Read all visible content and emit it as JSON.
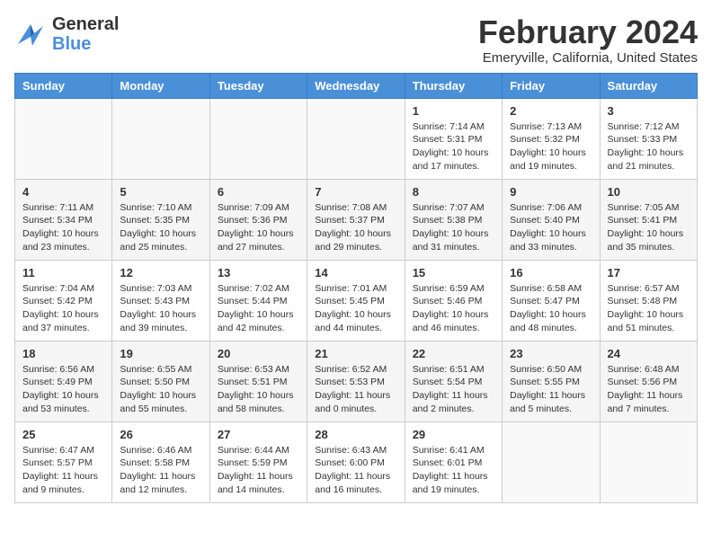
{
  "logo": {
    "general": "General",
    "blue": "Blue"
  },
  "title": "February 2024",
  "location": "Emeryville, California, United States",
  "days_of_week": [
    "Sunday",
    "Monday",
    "Tuesday",
    "Wednesday",
    "Thursday",
    "Friday",
    "Saturday"
  ],
  "weeks": [
    [
      {
        "day": "",
        "info": ""
      },
      {
        "day": "",
        "info": ""
      },
      {
        "day": "",
        "info": ""
      },
      {
        "day": "",
        "info": ""
      },
      {
        "day": "1",
        "info": "Sunrise: 7:14 AM\nSunset: 5:31 PM\nDaylight: 10 hours\nand 17 minutes."
      },
      {
        "day": "2",
        "info": "Sunrise: 7:13 AM\nSunset: 5:32 PM\nDaylight: 10 hours\nand 19 minutes."
      },
      {
        "day": "3",
        "info": "Sunrise: 7:12 AM\nSunset: 5:33 PM\nDaylight: 10 hours\nand 21 minutes."
      }
    ],
    [
      {
        "day": "4",
        "info": "Sunrise: 7:11 AM\nSunset: 5:34 PM\nDaylight: 10 hours\nand 23 minutes."
      },
      {
        "day": "5",
        "info": "Sunrise: 7:10 AM\nSunset: 5:35 PM\nDaylight: 10 hours\nand 25 minutes."
      },
      {
        "day": "6",
        "info": "Sunrise: 7:09 AM\nSunset: 5:36 PM\nDaylight: 10 hours\nand 27 minutes."
      },
      {
        "day": "7",
        "info": "Sunrise: 7:08 AM\nSunset: 5:37 PM\nDaylight: 10 hours\nand 29 minutes."
      },
      {
        "day": "8",
        "info": "Sunrise: 7:07 AM\nSunset: 5:38 PM\nDaylight: 10 hours\nand 31 minutes."
      },
      {
        "day": "9",
        "info": "Sunrise: 7:06 AM\nSunset: 5:40 PM\nDaylight: 10 hours\nand 33 minutes."
      },
      {
        "day": "10",
        "info": "Sunrise: 7:05 AM\nSunset: 5:41 PM\nDaylight: 10 hours\nand 35 minutes."
      }
    ],
    [
      {
        "day": "11",
        "info": "Sunrise: 7:04 AM\nSunset: 5:42 PM\nDaylight: 10 hours\nand 37 minutes."
      },
      {
        "day": "12",
        "info": "Sunrise: 7:03 AM\nSunset: 5:43 PM\nDaylight: 10 hours\nand 39 minutes."
      },
      {
        "day": "13",
        "info": "Sunrise: 7:02 AM\nSunset: 5:44 PM\nDaylight: 10 hours\nand 42 minutes."
      },
      {
        "day": "14",
        "info": "Sunrise: 7:01 AM\nSunset: 5:45 PM\nDaylight: 10 hours\nand 44 minutes."
      },
      {
        "day": "15",
        "info": "Sunrise: 6:59 AM\nSunset: 5:46 PM\nDaylight: 10 hours\nand 46 minutes."
      },
      {
        "day": "16",
        "info": "Sunrise: 6:58 AM\nSunset: 5:47 PM\nDaylight: 10 hours\nand 48 minutes."
      },
      {
        "day": "17",
        "info": "Sunrise: 6:57 AM\nSunset: 5:48 PM\nDaylight: 10 hours\nand 51 minutes."
      }
    ],
    [
      {
        "day": "18",
        "info": "Sunrise: 6:56 AM\nSunset: 5:49 PM\nDaylight: 10 hours\nand 53 minutes."
      },
      {
        "day": "19",
        "info": "Sunrise: 6:55 AM\nSunset: 5:50 PM\nDaylight: 10 hours\nand 55 minutes."
      },
      {
        "day": "20",
        "info": "Sunrise: 6:53 AM\nSunset: 5:51 PM\nDaylight: 10 hours\nand 58 minutes."
      },
      {
        "day": "21",
        "info": "Sunrise: 6:52 AM\nSunset: 5:53 PM\nDaylight: 11 hours\nand 0 minutes."
      },
      {
        "day": "22",
        "info": "Sunrise: 6:51 AM\nSunset: 5:54 PM\nDaylight: 11 hours\nand 2 minutes."
      },
      {
        "day": "23",
        "info": "Sunrise: 6:50 AM\nSunset: 5:55 PM\nDaylight: 11 hours\nand 5 minutes."
      },
      {
        "day": "24",
        "info": "Sunrise: 6:48 AM\nSunset: 5:56 PM\nDaylight: 11 hours\nand 7 minutes."
      }
    ],
    [
      {
        "day": "25",
        "info": "Sunrise: 6:47 AM\nSunset: 5:57 PM\nDaylight: 11 hours\nand 9 minutes."
      },
      {
        "day": "26",
        "info": "Sunrise: 6:46 AM\nSunset: 5:58 PM\nDaylight: 11 hours\nand 12 minutes."
      },
      {
        "day": "27",
        "info": "Sunrise: 6:44 AM\nSunset: 5:59 PM\nDaylight: 11 hours\nand 14 minutes."
      },
      {
        "day": "28",
        "info": "Sunrise: 6:43 AM\nSunset: 6:00 PM\nDaylight: 11 hours\nand 16 minutes."
      },
      {
        "day": "29",
        "info": "Sunrise: 6:41 AM\nSunset: 6:01 PM\nDaylight: 11 hours\nand 19 minutes."
      },
      {
        "day": "",
        "info": ""
      },
      {
        "day": "",
        "info": ""
      }
    ]
  ]
}
